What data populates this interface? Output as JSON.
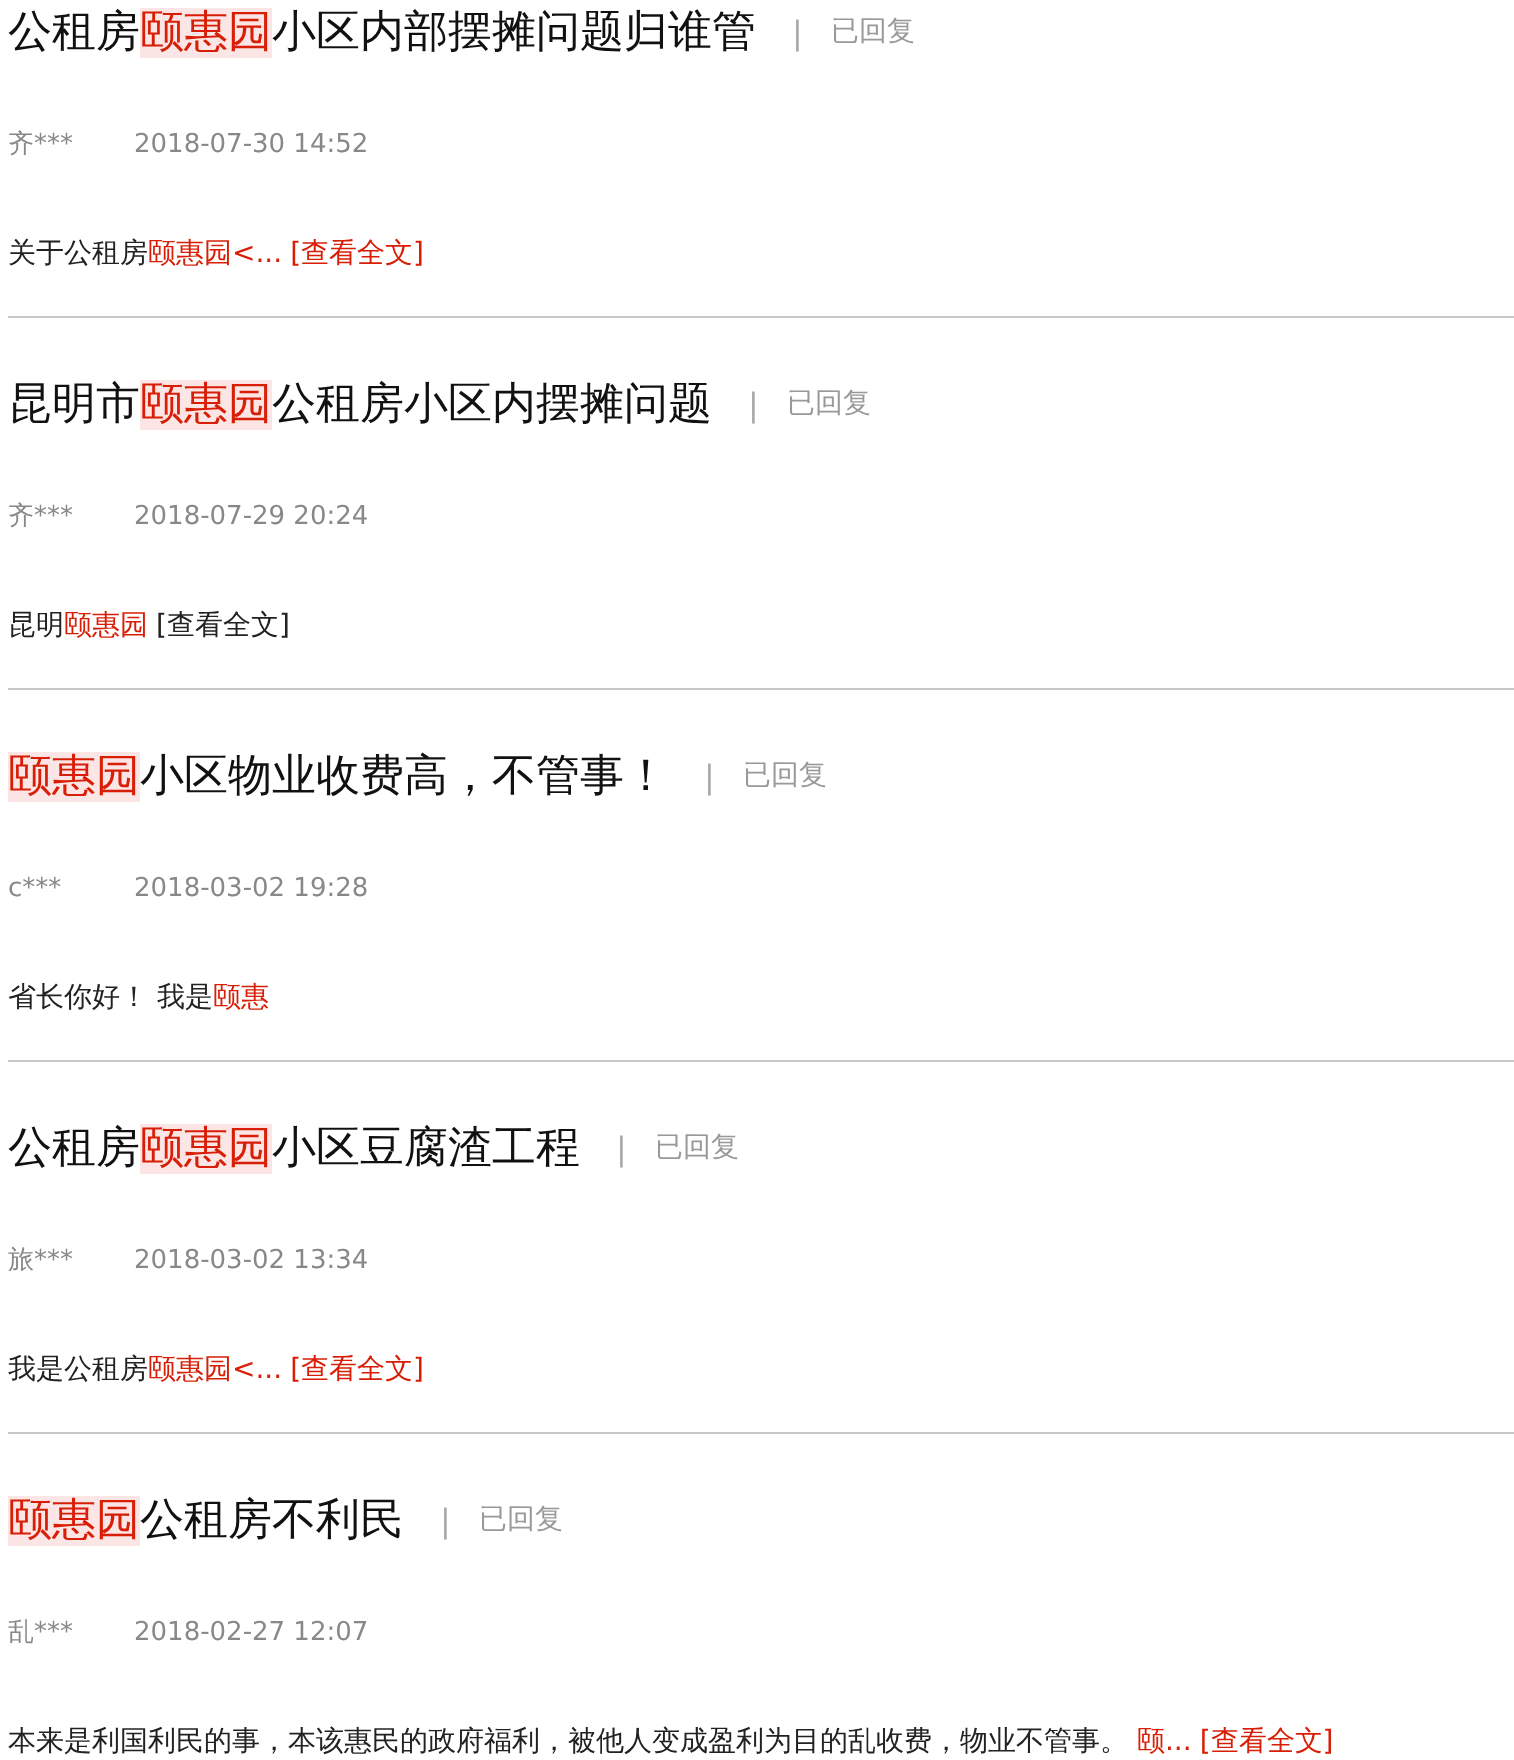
{
  "posts": [
    {
      "title": [
        {
          "text": "公租房",
          "highlight": false
        },
        {
          "text": "颐惠园",
          "highlight": true
        },
        {
          "text": "小区内部摆摊问题归谁管",
          "highlight": false
        }
      ],
      "separator": "|",
      "status": "已回复",
      "author": "齐***",
      "date": "2018-07-30 14:52",
      "excerpt": [
        {
          "text": "关于公租房",
          "highlight": false
        },
        {
          "text": "颐惠园<...",
          "highlight": true
        }
      ],
      "more": {
        "text": "[查看全文]",
        "highlight": true
      }
    },
    {
      "title": [
        {
          "text": "昆明市",
          "highlight": false
        },
        {
          "text": "颐惠园",
          "highlight": true
        },
        {
          "text": "公租房小区内摆摊问题",
          "highlight": false
        }
      ],
      "separator": "|",
      "status": "已回复",
      "author": "齐***",
      "date": "2018-07-29 20:24",
      "excerpt": [
        {
          "text": "昆明",
          "highlight": false
        },
        {
          "text": "颐惠园",
          "highlight": true
        }
      ],
      "more": {
        "text": "[查看全文]",
        "highlight": false
      }
    },
    {
      "title": [
        {
          "text": "颐惠园",
          "highlight": true
        },
        {
          "text": "小区物业收费高，不管事！",
          "highlight": false
        }
      ],
      "separator": "|",
      "status": "已回复",
      "author": "c***",
      "date": "2018-03-02 19:28",
      "excerpt": [
        {
          "text": "省长你好！ 我是",
          "highlight": false
        },
        {
          "text": "颐惠",
          "highlight": true
        }
      ]
    },
    {
      "title": [
        {
          "text": "公租房",
          "highlight": false
        },
        {
          "text": "颐惠园",
          "highlight": true
        },
        {
          "text": "小区豆腐渣工程",
          "highlight": false
        }
      ],
      "separator": "|",
      "status": "已回复",
      "author": "旅***",
      "date": "2018-03-02 13:34",
      "excerpt": [
        {
          "text": "我是公租房",
          "highlight": false
        },
        {
          "text": "颐惠园<...",
          "highlight": true
        }
      ],
      "more": {
        "text": "[查看全文]",
        "highlight": true
      }
    },
    {
      "title": [
        {
          "text": "颐惠园",
          "highlight": true
        },
        {
          "text": "公租房不利民",
          "highlight": false
        }
      ],
      "separator": "|",
      "status": "已回复",
      "author": "乱***",
      "date": "2018-02-27 12:07",
      "excerpt": [
        {
          "text": "本来是利国利民的事，本该惠民的政府福利，被他人变成盈利为目的乱收费，物业不管事。 ",
          "highlight": false
        },
        {
          "text": "颐...",
          "highlight": true
        }
      ],
      "more": {
        "text": "[查看全文]",
        "highlight": true
      }
    }
  ]
}
